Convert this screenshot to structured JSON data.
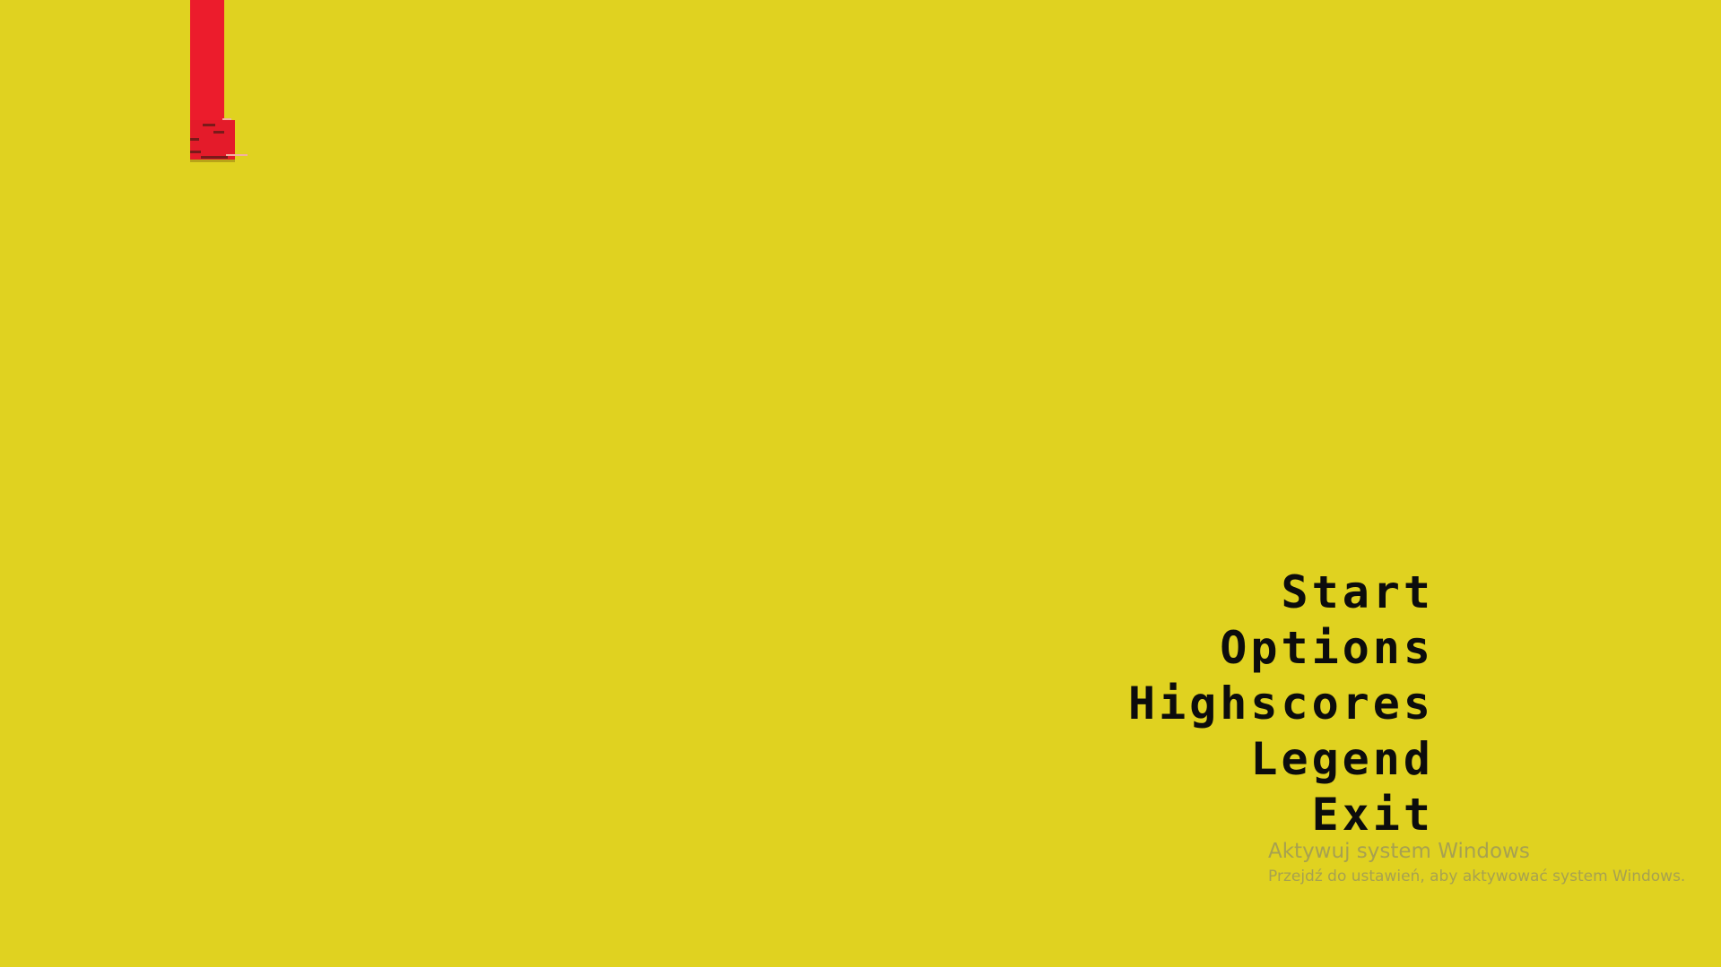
{
  "game": {
    "background_color": "#e0d220",
    "sprite_color": "#ec1c2c",
    "sprite_name": "red-pillar-sprite"
  },
  "menu": {
    "items": [
      {
        "label": "Start"
      },
      {
        "label": "Options"
      },
      {
        "label": "Highscores"
      },
      {
        "label": "Legend"
      },
      {
        "label": "Exit"
      }
    ]
  },
  "watermark": {
    "title": "Aktywuj system Windows",
    "subtitle": "Przejdź do ustawień, aby aktywować system Windows."
  }
}
